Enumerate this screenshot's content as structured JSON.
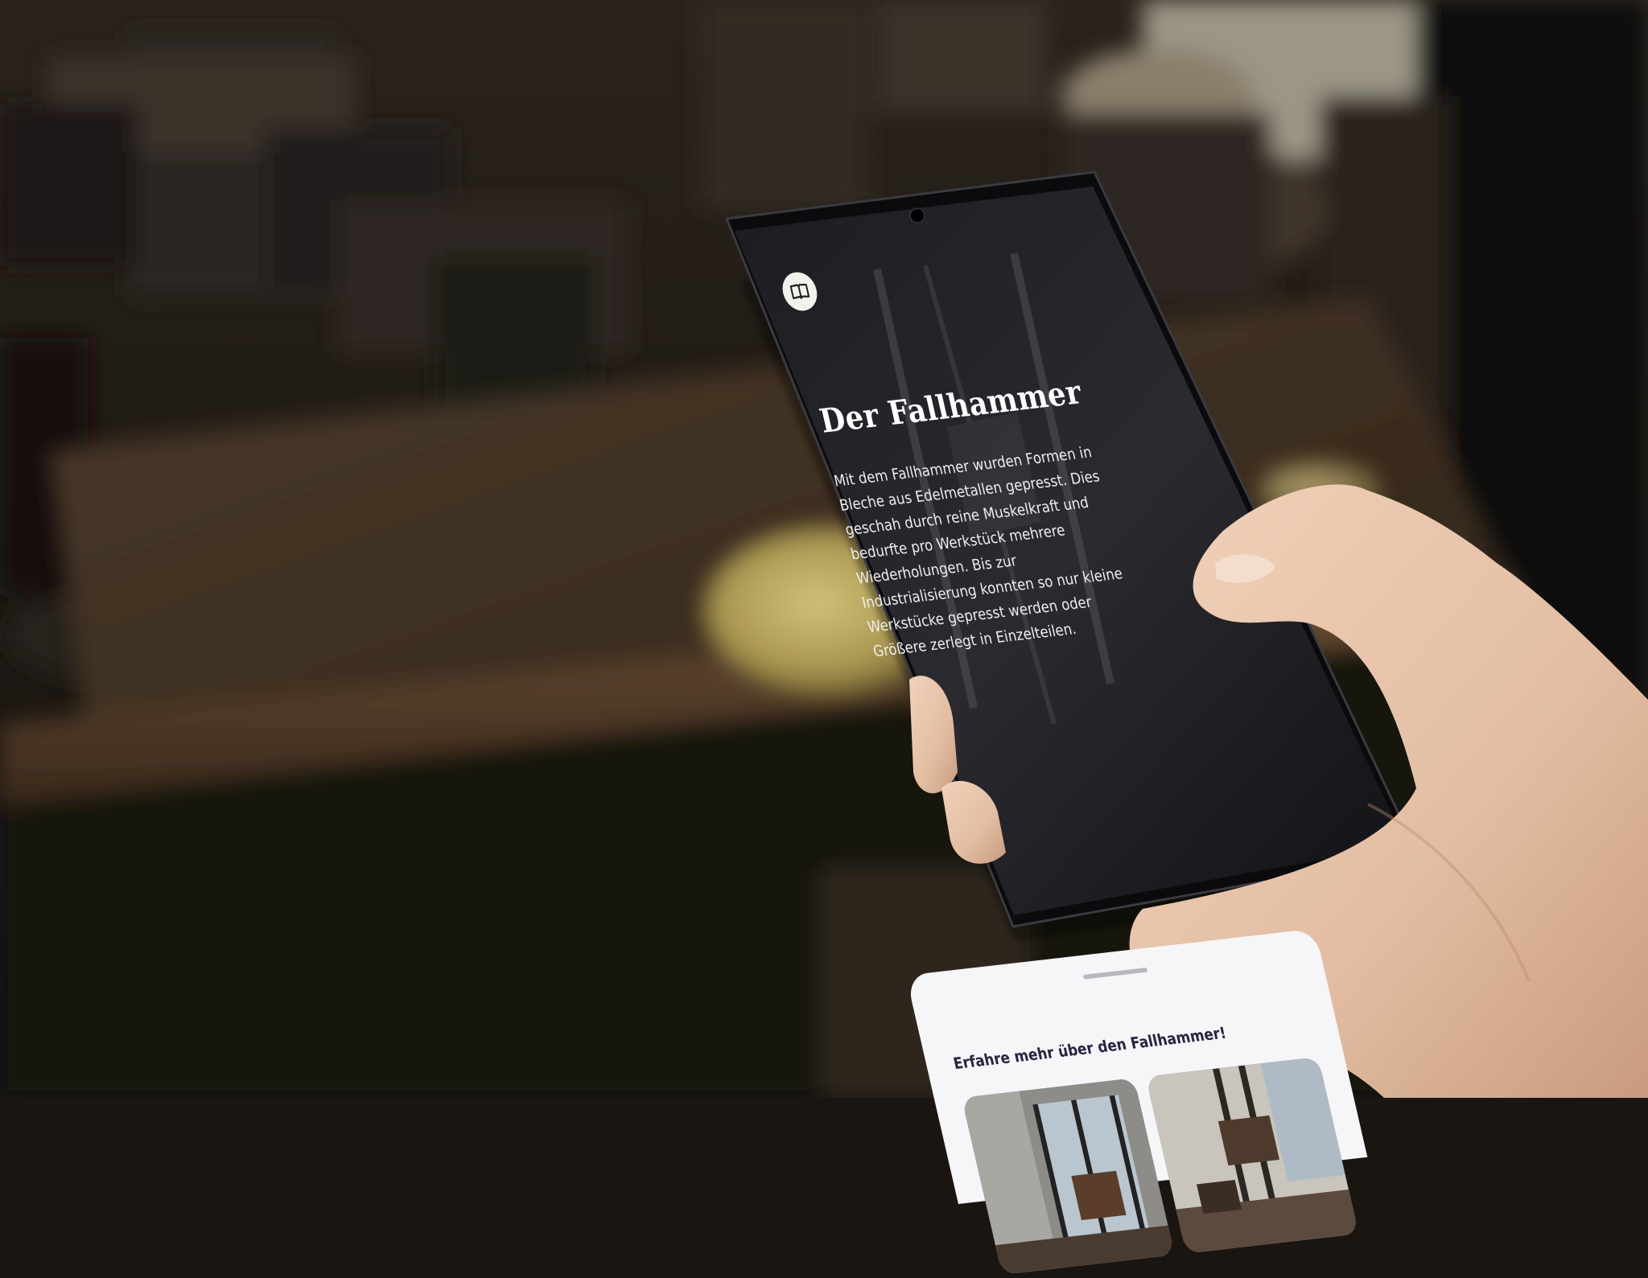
{
  "screen": {
    "menu_icon": "book-icon",
    "title": "Der Fallhammer",
    "body": "Mit dem Fallhammer wurden Formen in Bleche aus Edelmetallen gepresst. Dies geschah durch reine Muskelkraft und bedurfte pro Werkstück mehrere Wiederholungen. Bis zur Industrialisierung konnten so nur kleine Werkstücke gepresst werden oder Größere zerlegt in Einzelteilen.",
    "sheet": {
      "title": "Erfahre mehr über den Fallhammer!",
      "cards": [
        {
          "name": "fallhammer-photo-1"
        },
        {
          "name": "fallhammer-photo-2"
        }
      ]
    }
  },
  "colors": {
    "screen_background": "#16161a",
    "sheet_background": "#f6f5f8",
    "sheet_title": "#2b2340",
    "brass_plate": "#b3a15a",
    "table_wood": "#3c2d20",
    "skin": "#e6c3a8"
  }
}
